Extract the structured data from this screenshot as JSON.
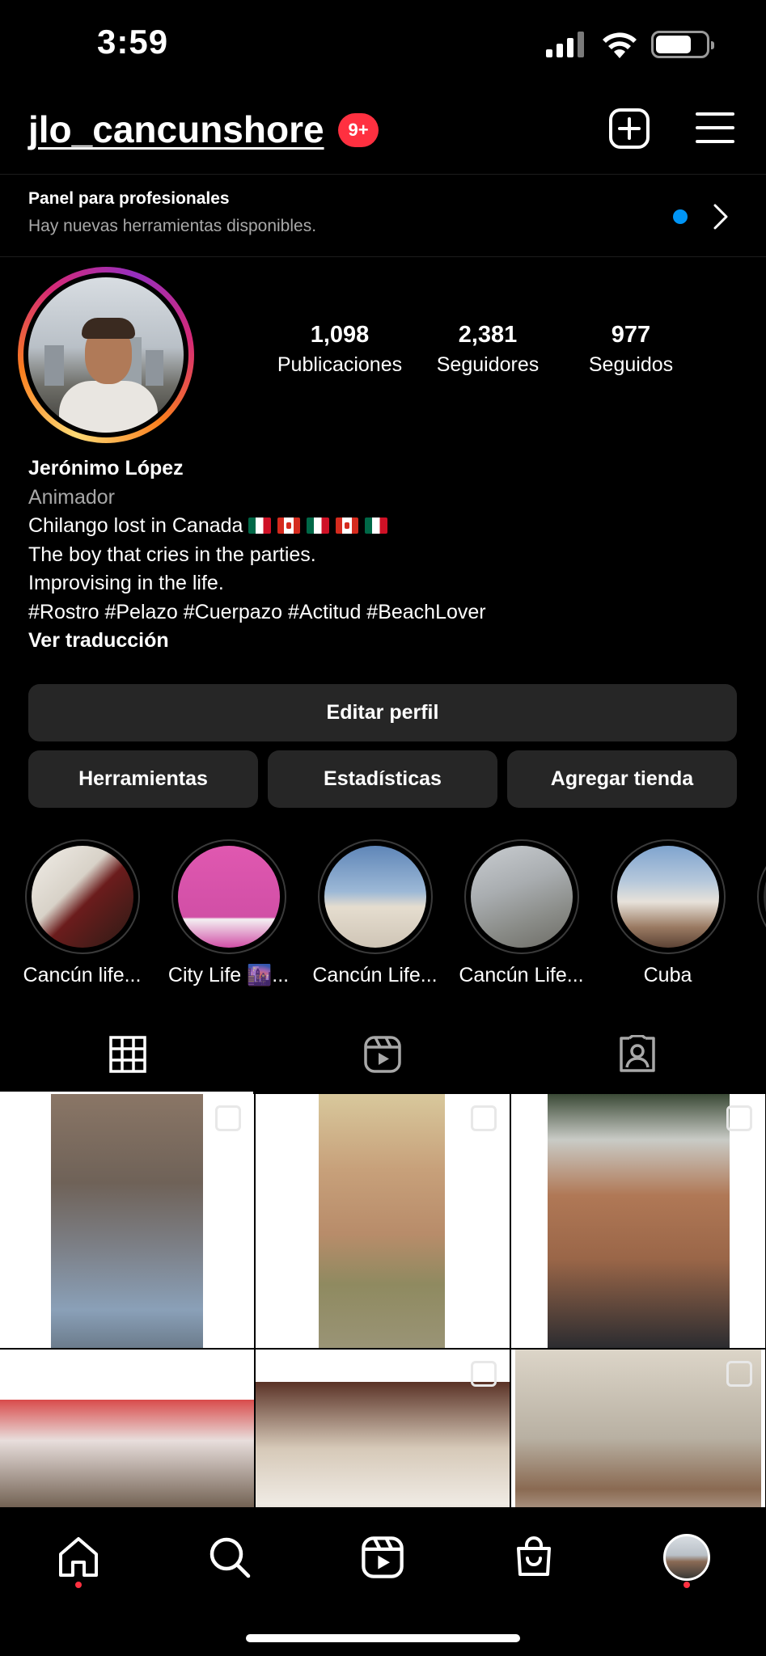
{
  "status_bar": {
    "time": "3:59"
  },
  "header": {
    "username": "jlo_cancunshore",
    "notification_badge": "9+"
  },
  "dashboard": {
    "title": "Panel para profesionales",
    "subtitle": "Hay nuevas herramientas disponibles."
  },
  "stats": [
    {
      "value": "1,098",
      "label": "Publicaciones"
    },
    {
      "value": "2,381",
      "label": "Seguidores"
    },
    {
      "value": "977",
      "label": "Seguidos"
    }
  ],
  "bio": {
    "name": "Jerónimo López",
    "category": "Animador",
    "line1": "Chilango lost in Canada",
    "line1_flags": [
      "mx",
      "ca",
      "mx",
      "ca",
      "mx"
    ],
    "line2": "The boy that cries in the parties.",
    "line3": "Improvising in the life.",
    "line4": "#Rostro #Pelazo #Cuerpazo #Actitud #BeachLover",
    "translate": "Ver traducción"
  },
  "buttons": {
    "edit_profile": "Editar perfil",
    "tools": "Herramientas",
    "insights": "Estadísticas",
    "add_shop": "Agregar tienda"
  },
  "highlights": [
    {
      "label": "Cancún life..."
    },
    {
      "label": "City Life 🌆..."
    },
    {
      "label": "Cancún Life..."
    },
    {
      "label": "Cancún Life..."
    },
    {
      "label": "Cuba"
    }
  ],
  "tabs": [
    {
      "icon": "grid-icon",
      "active": true
    },
    {
      "icon": "reels-icon",
      "active": false
    },
    {
      "icon": "tagged-icon",
      "active": false
    }
  ],
  "colors": {
    "accent_blue": "#0095f6",
    "badge_red": "#ff3040",
    "button_gray": "#262626",
    "secondary_text": "#a8a8a8"
  },
  "bottom_nav": [
    "home-icon",
    "search-icon",
    "reels-icon",
    "shop-icon",
    "profile-avatar"
  ]
}
